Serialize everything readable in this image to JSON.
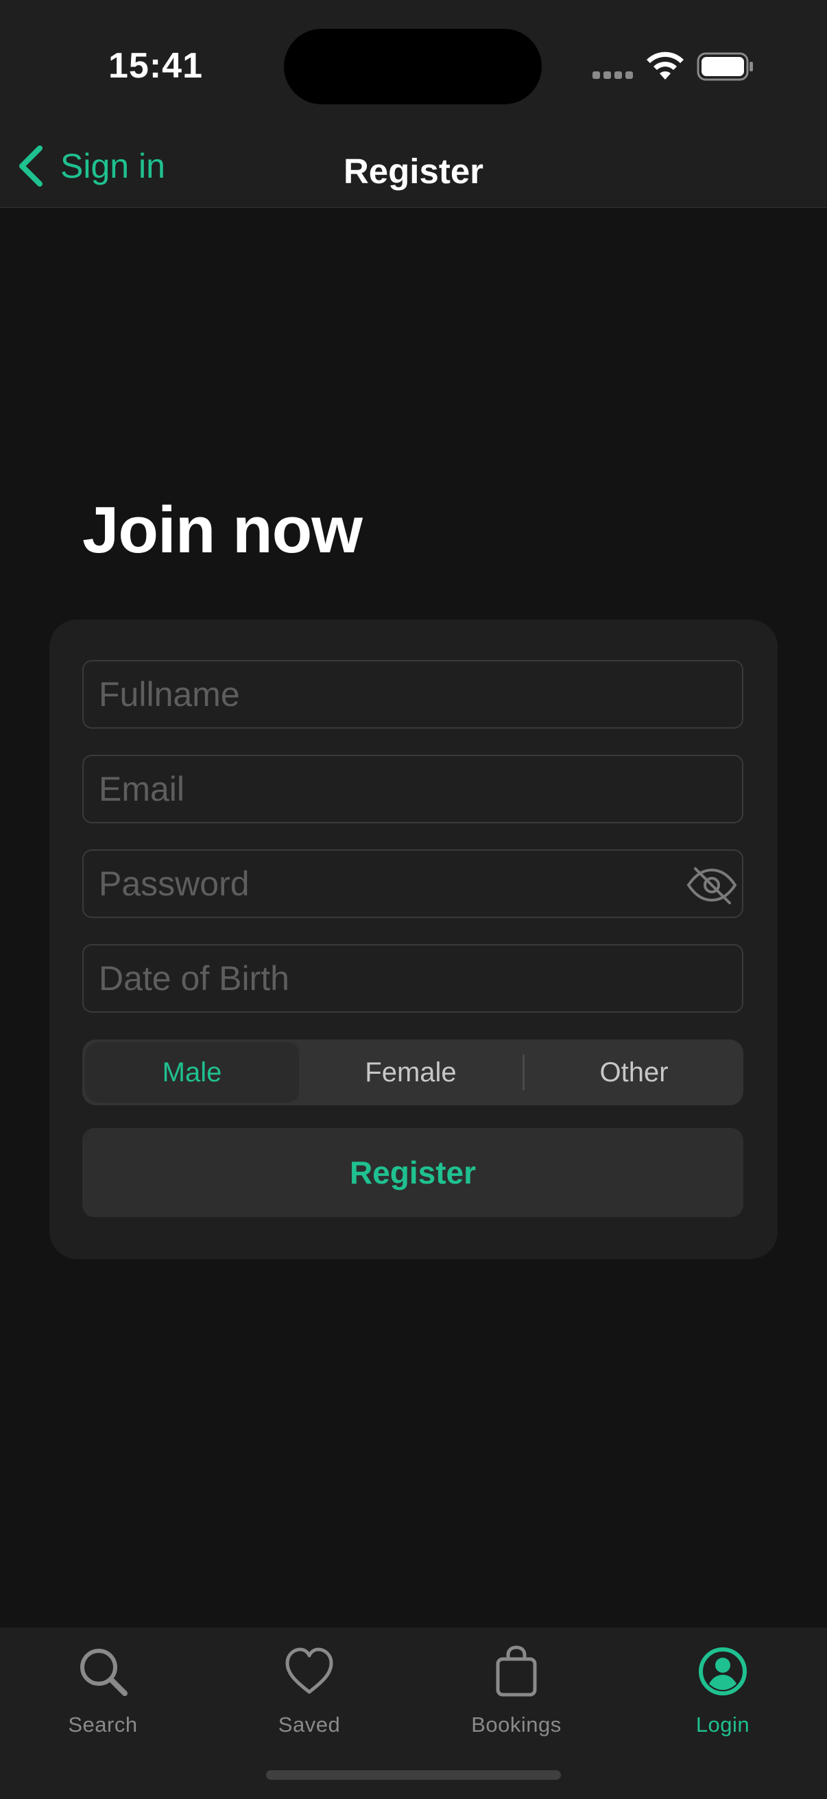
{
  "status_bar": {
    "time": "15:41"
  },
  "nav": {
    "back_label": "Sign in",
    "title": "Register"
  },
  "headline": "Join now",
  "form": {
    "fullname_placeholder": "Fullname",
    "email_placeholder": "Email",
    "password_placeholder": "Password",
    "dob_placeholder": "Date of Birth",
    "gender_options": [
      "Male",
      "Female",
      "Other"
    ],
    "gender_selected": "Male",
    "submit_label": "Register"
  },
  "tabs": [
    {
      "label": "Search",
      "icon": "search-icon"
    },
    {
      "label": "Saved",
      "icon": "heart-icon"
    },
    {
      "label": "Bookings",
      "icon": "bag-icon"
    },
    {
      "label": "Login",
      "icon": "person-circle-icon",
      "active": true
    }
  ],
  "colors": {
    "accent": "#1fc190",
    "background": "#131313",
    "surface": "#1f1f1f"
  }
}
